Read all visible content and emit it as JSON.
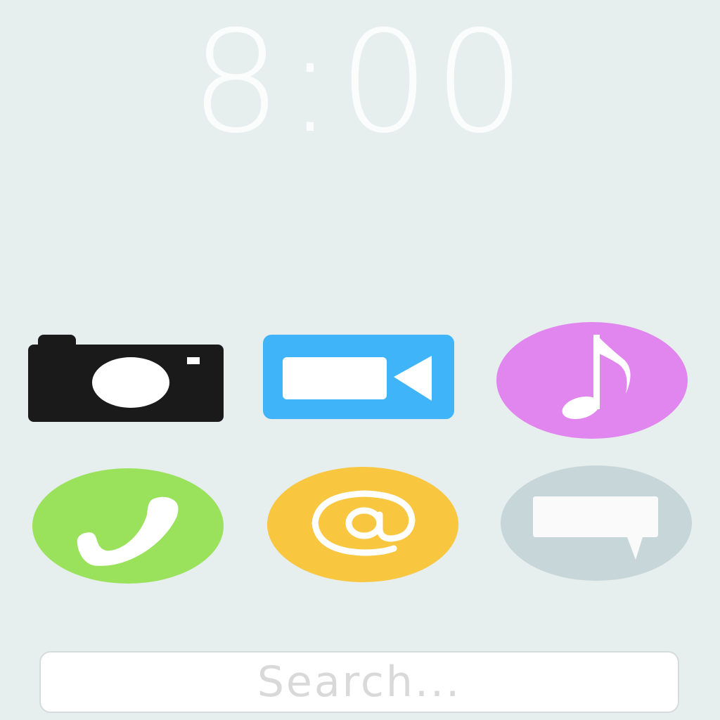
{
  "lockscreen": {
    "time": "8:00"
  },
  "apps": [
    {
      "id": "camera",
      "icon": "camera-icon",
      "color": "#1A1A1A"
    },
    {
      "id": "video",
      "icon": "video-camera-icon",
      "color": "#3FB4F8"
    },
    {
      "id": "music",
      "icon": "music-note-icon",
      "color": "#E186EE"
    },
    {
      "id": "phone",
      "icon": "phone-icon",
      "color": "#9BE25C"
    },
    {
      "id": "email",
      "icon": "at-sign-icon",
      "color": "#F8C63F"
    },
    {
      "id": "messages",
      "icon": "chat-bubble-icon",
      "color": "#C7D6D9"
    }
  ],
  "search": {
    "placeholder": "Search..."
  },
  "colors": {
    "background": "#E6EEEE",
    "clock": "#FBFDFD",
    "search_placeholder": "#D9D9D9"
  }
}
